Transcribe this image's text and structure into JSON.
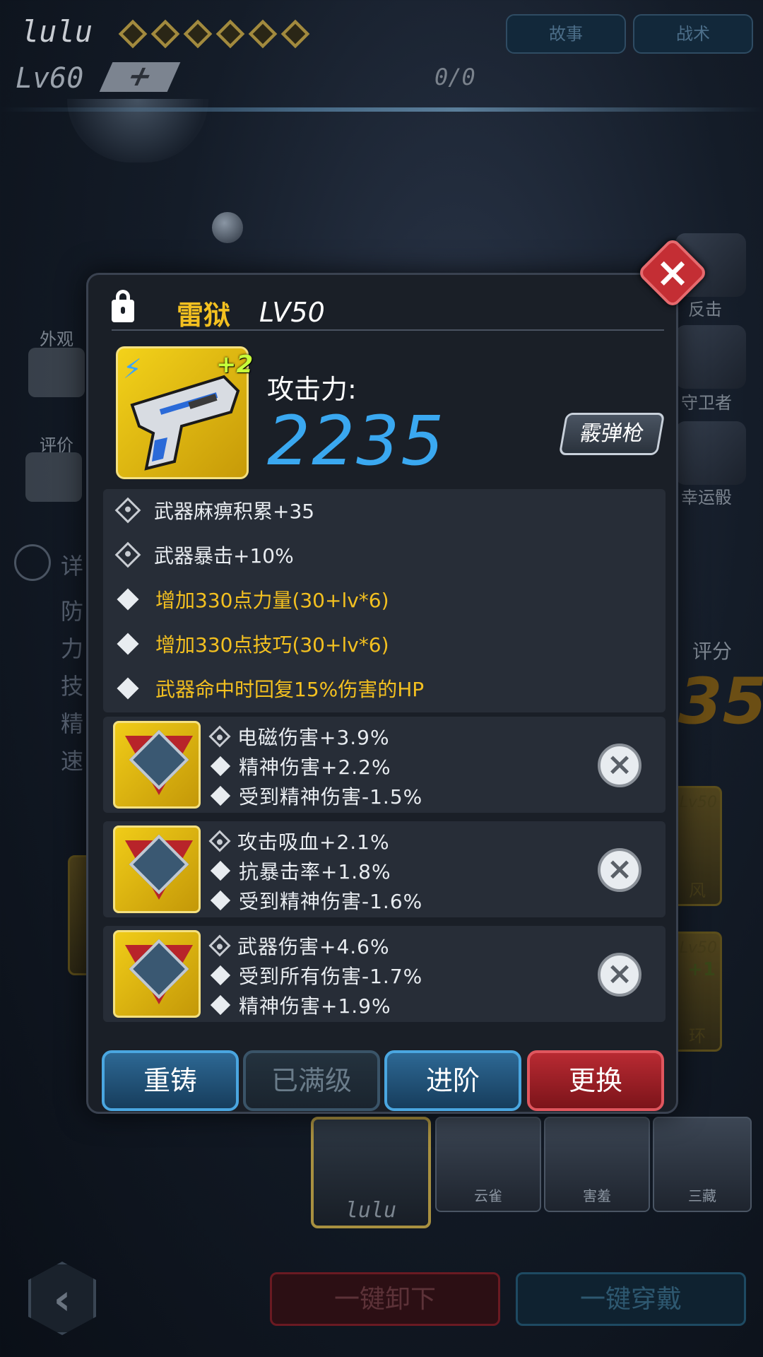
{
  "header": {
    "player_name": "lulu",
    "level": "Lv60",
    "plus_label": "+",
    "exp": "0/0",
    "tab_story": "故事",
    "tab_tactics": "战术"
  },
  "left_menu": {
    "appearance": "外观",
    "rating": "评价",
    "detail_initial": "详",
    "stats": [
      "防",
      "力",
      "技",
      "精",
      "速"
    ]
  },
  "right_menu": {
    "counter": "反击",
    "guardian": "守卫者",
    "lucky_dice": "幸运骰",
    "score_label": "评分",
    "score_value": "35",
    "card1_level": "Lv50",
    "card1_name": "风",
    "card2_level": "Lv50",
    "card2_plus": "+1",
    "card2_name": "环"
  },
  "heroes": {
    "current": "lulu",
    "list": [
      "云雀",
      "害羞",
      "三藏"
    ]
  },
  "bottom": {
    "unload_all": "一键卸下",
    "equip_all": "一键穿戴"
  },
  "popup": {
    "weapon_name": "雷狱",
    "weapon_level": "LV50",
    "upgrade_badge": "+2",
    "attack_label": "攻击力:",
    "attack_value": "2235",
    "weapon_type": "霰弹枪",
    "attributes": [
      {
        "text": "武器麻痹积累+35",
        "icon": "lock-diamond-icon",
        "color": "#e8ecf0"
      },
      {
        "text": "武器暴击+10%",
        "icon": "lock-diamond-icon",
        "color": "#e8ecf0"
      },
      {
        "text": "增加330点力量(30+lv*6)",
        "icon": "diamond-icon",
        "color": "#f3c020"
      },
      {
        "text": "增加330点技巧(30+lv*6)",
        "icon": "diamond-icon",
        "color": "#f3c020"
      },
      {
        "text": "武器命中时回复15%伤害的HP",
        "icon": "diamond-icon",
        "color": "#f3c020"
      }
    ],
    "gems": [
      {
        "lines": [
          "电磁伤害+3.9%",
          "精神伤害+2.2%",
          "受到精神伤害-1.5%"
        ]
      },
      {
        "lines": [
          "攻击吸血+2.1%",
          "抗暴击率+1.8%",
          "受到精神伤害-1.6%"
        ]
      },
      {
        "lines": [
          "武器伤害+4.6%",
          "受到所有伤害-1.7%",
          "精神伤害+1.9%"
        ]
      }
    ],
    "buttons": {
      "recast": "重铸",
      "maxed": "已满级",
      "advance": "进阶",
      "replace": "更换"
    }
  }
}
